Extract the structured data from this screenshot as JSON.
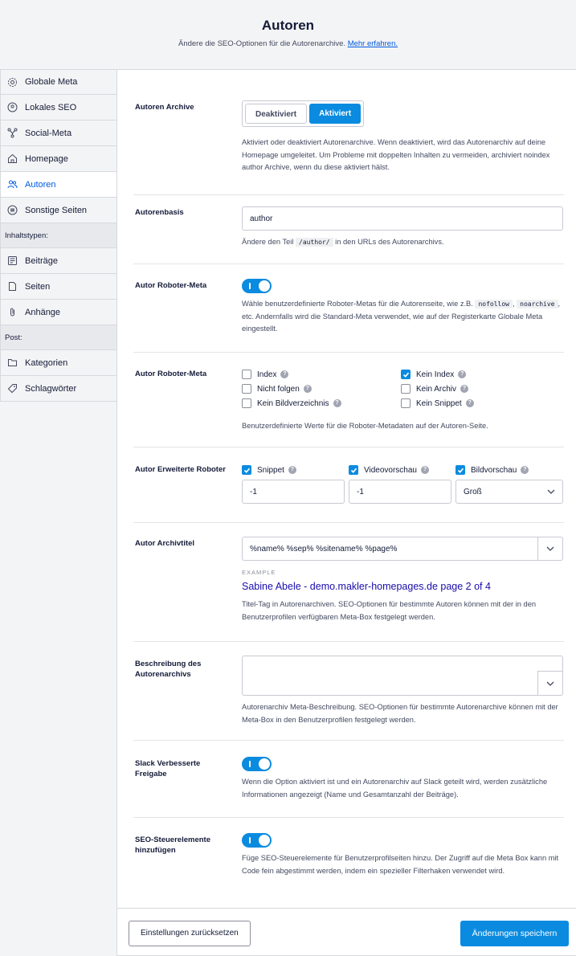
{
  "header": {
    "title": "Autoren",
    "subtitle": "Ändere die SEO-Optionen für die Autorenarchive.",
    "learn_more": "Mehr erfahren."
  },
  "sidebar": {
    "items": [
      {
        "label": "Globale Meta",
        "icon": "gear-icon"
      },
      {
        "label": "Lokales SEO",
        "icon": "location-pin-icon"
      },
      {
        "label": "Social-Meta",
        "icon": "share-network-icon"
      },
      {
        "label": "Homepage",
        "icon": "home-icon"
      },
      {
        "label": "Autoren",
        "icon": "users-icon"
      },
      {
        "label": "Sonstige Seiten",
        "icon": "list-circle-icon"
      }
    ],
    "section_content_types": "Inhaltstypen:",
    "content_types": [
      {
        "label": "Beiträge",
        "icon": "document-icon"
      },
      {
        "label": "Seiten",
        "icon": "page-icon"
      },
      {
        "label": "Anhänge",
        "icon": "paperclip-icon"
      }
    ],
    "section_post": "Post:",
    "taxonomies": [
      {
        "label": "Kategorien",
        "icon": "folder-icon"
      },
      {
        "label": "Schlagwörter",
        "icon": "tag-icon"
      }
    ]
  },
  "settings": {
    "archive": {
      "label": "Autoren Archive",
      "off": "Deaktiviert",
      "on": "Aktiviert",
      "desc": "Aktiviert oder deaktiviert Autorenarchive. Wenn deaktiviert, wird das Autorenarchiv auf deine Homepage umgeleitet. Um Probleme mit doppelten Inhalten zu vermeiden, archiviert noindex author Archive, wenn du diese aktiviert hälst."
    },
    "base": {
      "label": "Autorenbasis",
      "value": "author",
      "desc_pre": "Ändere den Teil",
      "desc_code": "/author/",
      "desc_post": "in den URLs des Autorenarchivs."
    },
    "robots_meta": {
      "label": "Autor Roboter-Meta",
      "desc_pre": "Wähle benutzerdefinierte Roboter-Metas für die Autorenseite, wie z.B.",
      "code1": "nofollow",
      "code2": "noarchive",
      "desc_post": ", etc. Andernfalls wird die Standard-Meta verwendet, wie auf der Registerkarte Globale Meta eingestellt."
    },
    "robots_values": {
      "label": "Autor Roboter-Meta",
      "options": [
        {
          "label": "Index",
          "checked": false
        },
        {
          "label": "Kein Index",
          "checked": true
        },
        {
          "label": "Nicht folgen",
          "checked": false
        },
        {
          "label": "Kein Archiv",
          "checked": false
        },
        {
          "label": "Kein Bildverzeichnis",
          "checked": false
        },
        {
          "label": "Kein Snippet",
          "checked": false
        }
      ],
      "desc": "Benutzerdefinierte Werte für die Roboter-Metadaten auf der Autoren-Seite."
    },
    "advanced": {
      "label": "Autor Erweiterte Roboter",
      "snippet": "Snippet",
      "snippet_value": "-1",
      "video": "Videovorschau",
      "video_value": "-1",
      "image": "Bildvorschau",
      "image_value": "Groß"
    },
    "archive_title": {
      "label": "Autor Archivtitel",
      "value": "%name% %sep% %sitename% %page%",
      "example_label": "EXAMPLE",
      "example": "Sabine Abele - demo.makler-homepages.de page 2 of 4",
      "desc": "Titel-Tag in Autorenarchiven. SEO-Optionen für bestimmte Autoren können mit der in den Benutzerprofilen verfügbaren Meta-Box festgelegt werden."
    },
    "description": {
      "label_1": "Beschreibung des",
      "label_2": "Autorenarchivs",
      "value": "",
      "desc": "Autorenarchiv Meta-Beschreibung. SEO-Optionen für bestimmte Autorenarchive können mit der Meta-Box in den Benutzerprofilen festgelegt werden."
    },
    "slack": {
      "label_1": "Slack Verbesserte",
      "label_2": "Freigabe",
      "desc": "Wenn die Option aktiviert ist und ein Autorenarchiv auf Slack geteilt wird, werden zusätzliche Informationen angezeigt (Name und Gesamtanzahl der Beiträge)."
    },
    "seo_controls": {
      "label_1": "SEO-Steuerelemente",
      "label_2": "hinzufügen",
      "desc": "Füge SEO-Steuerelemente für Benutzerprofilseiten hinzu. Der Zugriff auf die Meta Box kann mit Code fein abgestimmt werden, indem ein spezieller Filterhaken verwendet wird."
    }
  },
  "footer": {
    "reset": "Einstellungen zurücksetzen",
    "save": "Änderungen speichern"
  },
  "colors": {
    "accent": "#0a8be0",
    "link": "#005ae0",
    "example_link": "#1a0dab"
  }
}
